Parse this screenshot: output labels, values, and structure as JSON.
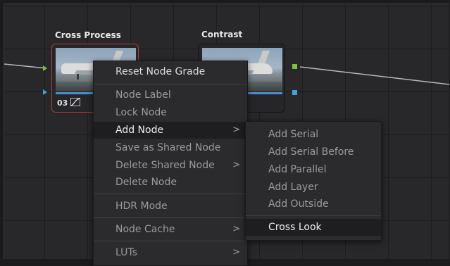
{
  "nodes": [
    {
      "title": "Cross Process",
      "number": "03",
      "tool_icon": "curves-icon"
    },
    {
      "title": "Contrast"
    }
  ],
  "context_menu": [
    {
      "label": "Reset Node Grade"
    },
    {
      "label": "Node Label"
    },
    {
      "label": "Lock Node"
    },
    {
      "label": "Add Node",
      "arrow": ">"
    },
    {
      "label": "Save as Shared Node"
    },
    {
      "label": "Delete Shared Node",
      "arrow": ">"
    },
    {
      "label": "Delete Node"
    },
    {
      "label": "HDR Mode"
    },
    {
      "label": "Node Cache",
      "arrow": ">"
    },
    {
      "label": "LUTs",
      "arrow": ">"
    }
  ],
  "submenu": [
    {
      "label": "Add Serial"
    },
    {
      "label": "Add Serial Before"
    },
    {
      "label": "Add Parallel"
    },
    {
      "label": "Add Layer"
    },
    {
      "label": "Add Outside"
    },
    {
      "label": "Cross Look"
    }
  ],
  "colors": {
    "selected_outline": "#a9403f",
    "rgb_port": "#7cc23a",
    "alpha_port": "#3fa0de",
    "menu_bg": "#2b2b2e"
  }
}
